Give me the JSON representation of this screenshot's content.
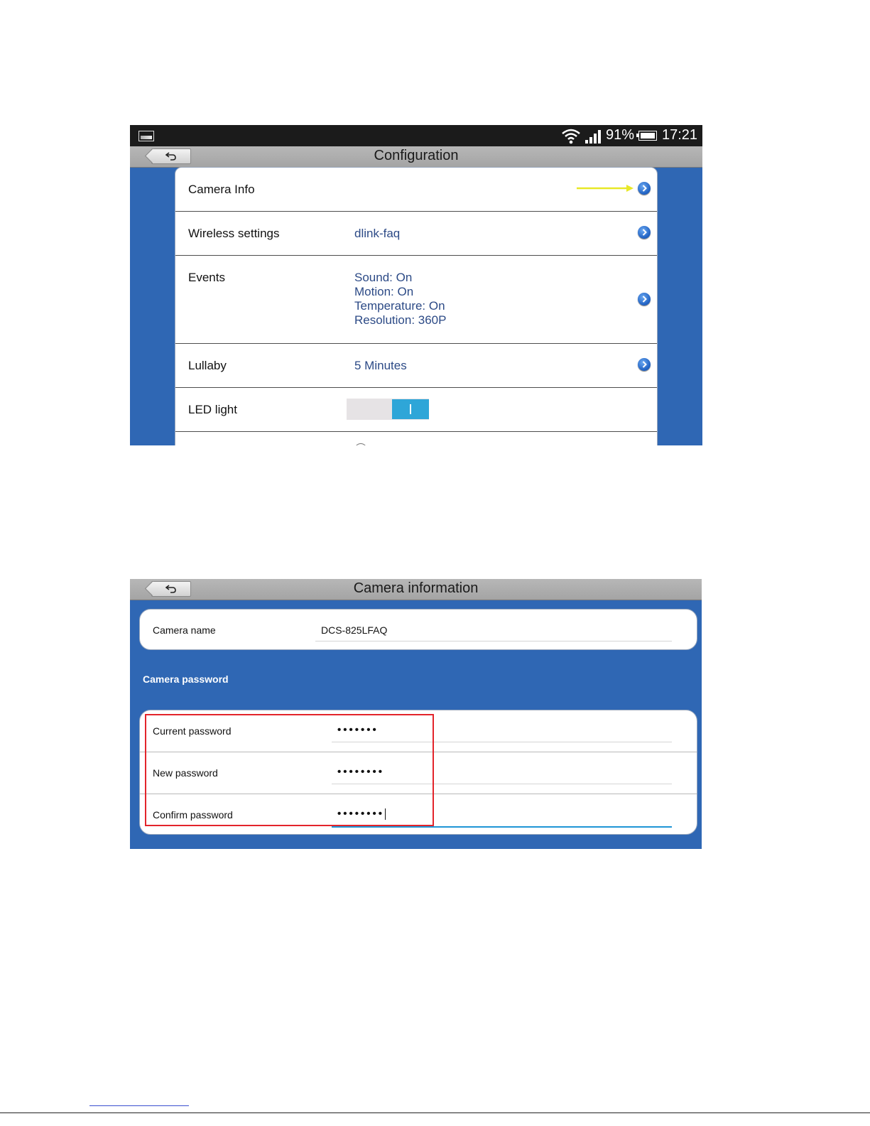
{
  "status_bar": {
    "image_icon": "gallery-icon",
    "wifi_icon": "wifi-icon",
    "signal_icon": "signal-icon",
    "battery_percent": "91%",
    "battery_icon": "battery-icon",
    "time": "17:21"
  },
  "configuration": {
    "back_icon": "back-arrow-icon",
    "title": "Configuration",
    "rows": [
      {
        "label": "Camera Info",
        "value": "",
        "has_chevron": true,
        "highlighted_by_arrow": true
      },
      {
        "label": "Wireless settings",
        "value": "dlink-faq",
        "has_chevron": true
      },
      {
        "label": "Events",
        "values": [
          "Sound: On",
          "Motion: On",
          "Temperature: On",
          "Resolution: 360P"
        ],
        "has_chevron": true
      },
      {
        "label": "Lullaby",
        "value": "5 Minutes",
        "has_chevron": true
      },
      {
        "label": "LED light",
        "toggle": "on"
      }
    ],
    "arrow_color": "#e8e827",
    "toggle_color": "#2ea6d8"
  },
  "camera_information": {
    "back_icon": "back-arrow-icon",
    "title": "Camera information",
    "camera_name_label": "Camera name",
    "camera_name_value": "DCS-825LFAQ",
    "section_label": "Camera password",
    "current_password_label": "Current password",
    "current_password_value": "•••••••",
    "new_password_label": "New password",
    "new_password_value": "••••••••",
    "confirm_password_label": "Confirm password",
    "confirm_password_value": "••••••••",
    "highlight_color": "#e3242b"
  },
  "colors": {
    "background_blue": "#2f67b4",
    "value_text": "#2c4a86"
  }
}
